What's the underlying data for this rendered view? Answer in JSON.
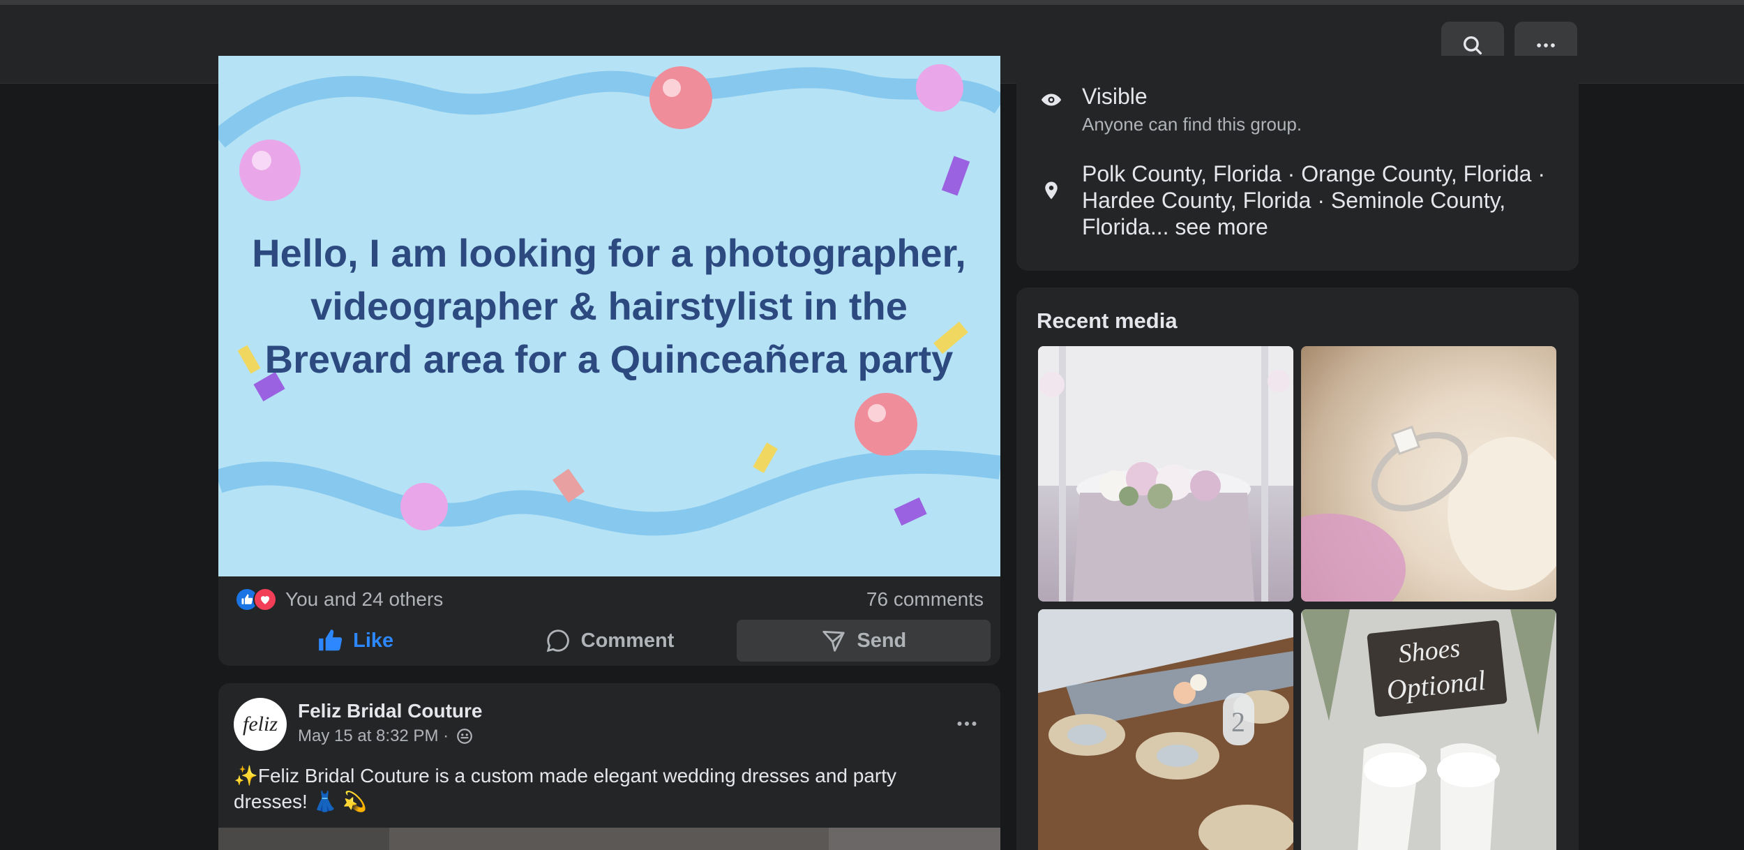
{
  "topbar": {
    "search_icon": "search-icon",
    "more_icon": "more-horizontal-icon"
  },
  "post1": {
    "image_text": "Hello, I am looking for a photographer, videographer & hairstylist in the Brevard area for a Quinceañera party",
    "reactions_text": "You and 24 others",
    "comments_count": "76 comments",
    "actions": {
      "like": "Like",
      "comment": "Comment",
      "send": "Send"
    },
    "colors": {
      "like_active": "#2d88ff",
      "image_bg": "#b5e2f4",
      "image_text": "#2c4a80"
    }
  },
  "post2": {
    "author": "Feliz Bridal Couture",
    "avatar_text": "feliz",
    "timestamp": "May 15 at 8:32 PM ·",
    "text": "✨Feliz Bridal Couture is a custom made elegant wedding dresses and party dresses! 👗 💫"
  },
  "about": {
    "visibility_title": "Visible",
    "visibility_sub": "Anyone can find this group.",
    "location_text": "Polk County, Florida · Orange County, Florida · Hardee County, Florida · Seminole County, Florida... see more"
  },
  "recent_media": {
    "title": "Recent media",
    "tile4_sign_line1": "Shoes",
    "tile4_sign_line2": "Optional",
    "tile3_table_number": "2"
  }
}
